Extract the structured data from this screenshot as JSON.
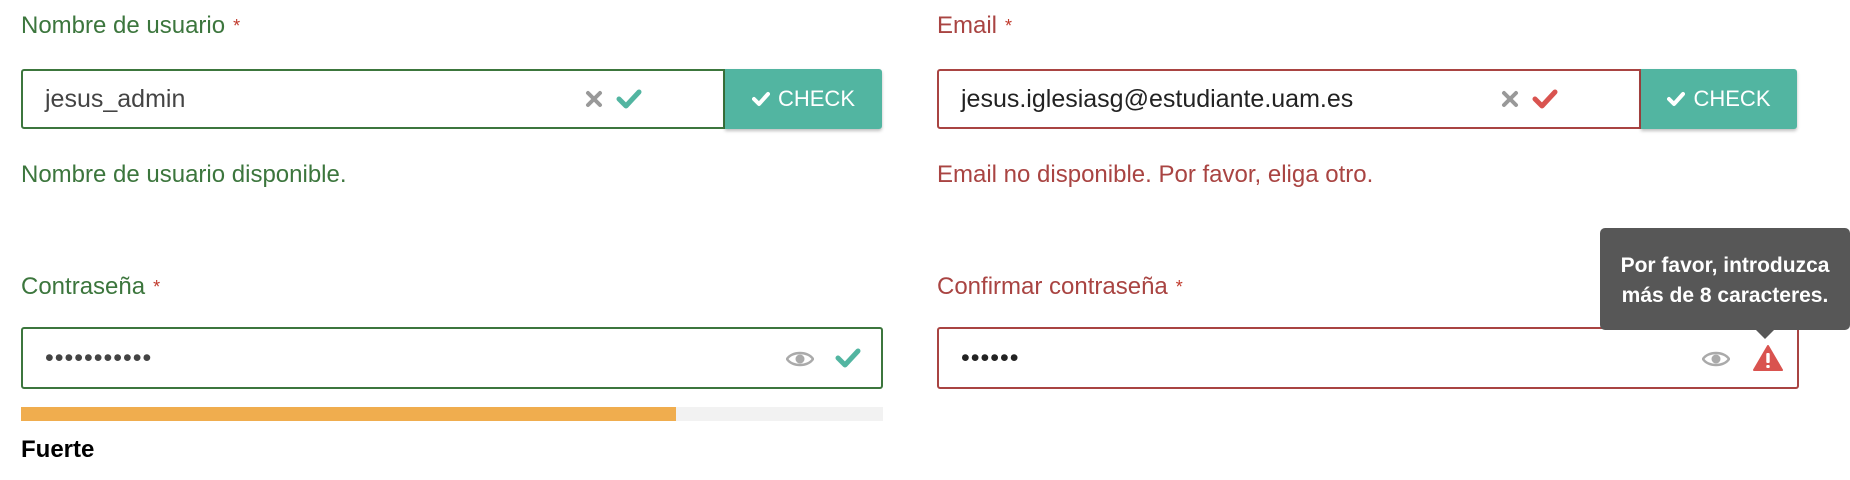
{
  "username": {
    "label": "Nombre de usuario",
    "required_mark": "*",
    "value": "jesus_admin",
    "check_label": "CHECK",
    "message": "Nombre de usuario disponible."
  },
  "email": {
    "label": "Email",
    "required_mark": "*",
    "value": "jesus.iglesiasg@estudiante.uam.es",
    "check_label": "CHECK",
    "message": "Email no disponible. Por favor, eliga otro."
  },
  "password": {
    "label": "Contraseña",
    "required_mark": "*",
    "masked_value": "•••••••••••",
    "strength_label": "Fuerte",
    "strength_fraction": 0.76
  },
  "confirm_password": {
    "label": "Confirmar contraseña",
    "required_mark": "*",
    "masked_value": "••••••",
    "tooltip_line1": "Por favor, introduzca",
    "tooltip_line2": "más de 8 caracteres."
  },
  "colors": {
    "success": "#3c763d",
    "error": "#a94442",
    "accent": "#52b5a1",
    "strength": "#f0ad4e",
    "tooltip_bg": "#575757"
  },
  "icons": [
    "clear-icon",
    "check-icon",
    "eye-icon",
    "warning-icon"
  ]
}
